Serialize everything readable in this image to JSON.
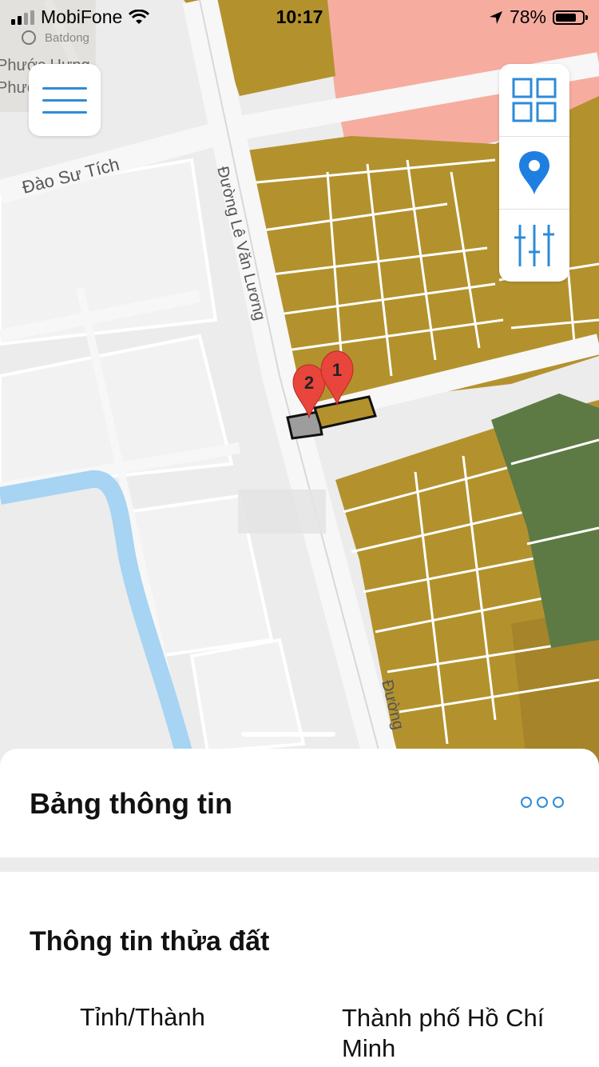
{
  "status_bar": {
    "carrier": "MobiFone",
    "time": "10:17",
    "battery": "78%",
    "battery_level": 0.78
  },
  "map": {
    "street_dao_su_tich": "Đào Sư Tích",
    "street_le_van_luong": "Đường Lê Văn Lương",
    "street_bottom": "Đường",
    "corner_place_1": "Batdong",
    "corner_place_2": "Phước Hưng",
    "corner_place_3": "Phước",
    "marker_1": "1",
    "marker_2": "2",
    "colors": {
      "residential": "#b3922e",
      "green_zone": "#5d7a45",
      "pink_zone": "#f6ada0",
      "water": "#a6d4f2",
      "road": "#f7f7f7"
    }
  },
  "toolbar": {
    "menu_icon": "hamburger-icon",
    "layers_icon": "grid-icon",
    "location_icon": "location-pin-icon",
    "filter_icon": "sliders-icon"
  },
  "sheet": {
    "title": "Bảng thông tin",
    "more_icon": "more-options-icon",
    "section_title": "Thông tin thửa đất",
    "rows": [
      {
        "label": "Tỉnh/Thành",
        "value": "Thành phố Hồ Chí Minh"
      }
    ]
  }
}
